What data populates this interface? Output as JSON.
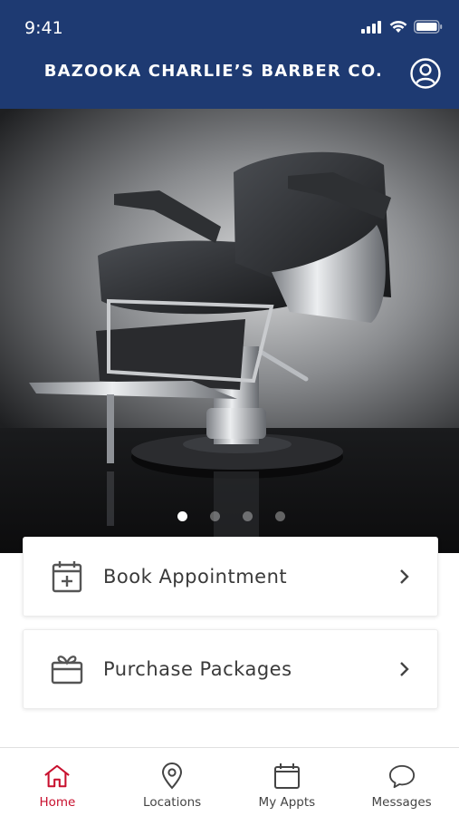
{
  "status_bar": {
    "time": "9:41"
  },
  "header": {
    "title": "BAZOOKA CHARLIE’S BARBER CO."
  },
  "carousel": {
    "slide_count": 4,
    "active_index": 0
  },
  "actions": [
    {
      "label": "Book Appointment",
      "icon": "calendar-plus-icon"
    },
    {
      "label": "Purchase Packages",
      "icon": "gift-icon"
    }
  ],
  "tabbar": {
    "items": [
      {
        "label": "Home",
        "icon": "home-icon",
        "active": true
      },
      {
        "label": "Locations",
        "icon": "map-pin-icon",
        "active": false
      },
      {
        "label": "My Appts",
        "icon": "calendar-icon",
        "active": false
      },
      {
        "label": "Messages",
        "icon": "chat-bubble-icon",
        "active": false
      }
    ]
  },
  "colors": {
    "header_bg": "#1e3a72",
    "active_tab": "#c8102e",
    "icon_gray": "#555555"
  }
}
